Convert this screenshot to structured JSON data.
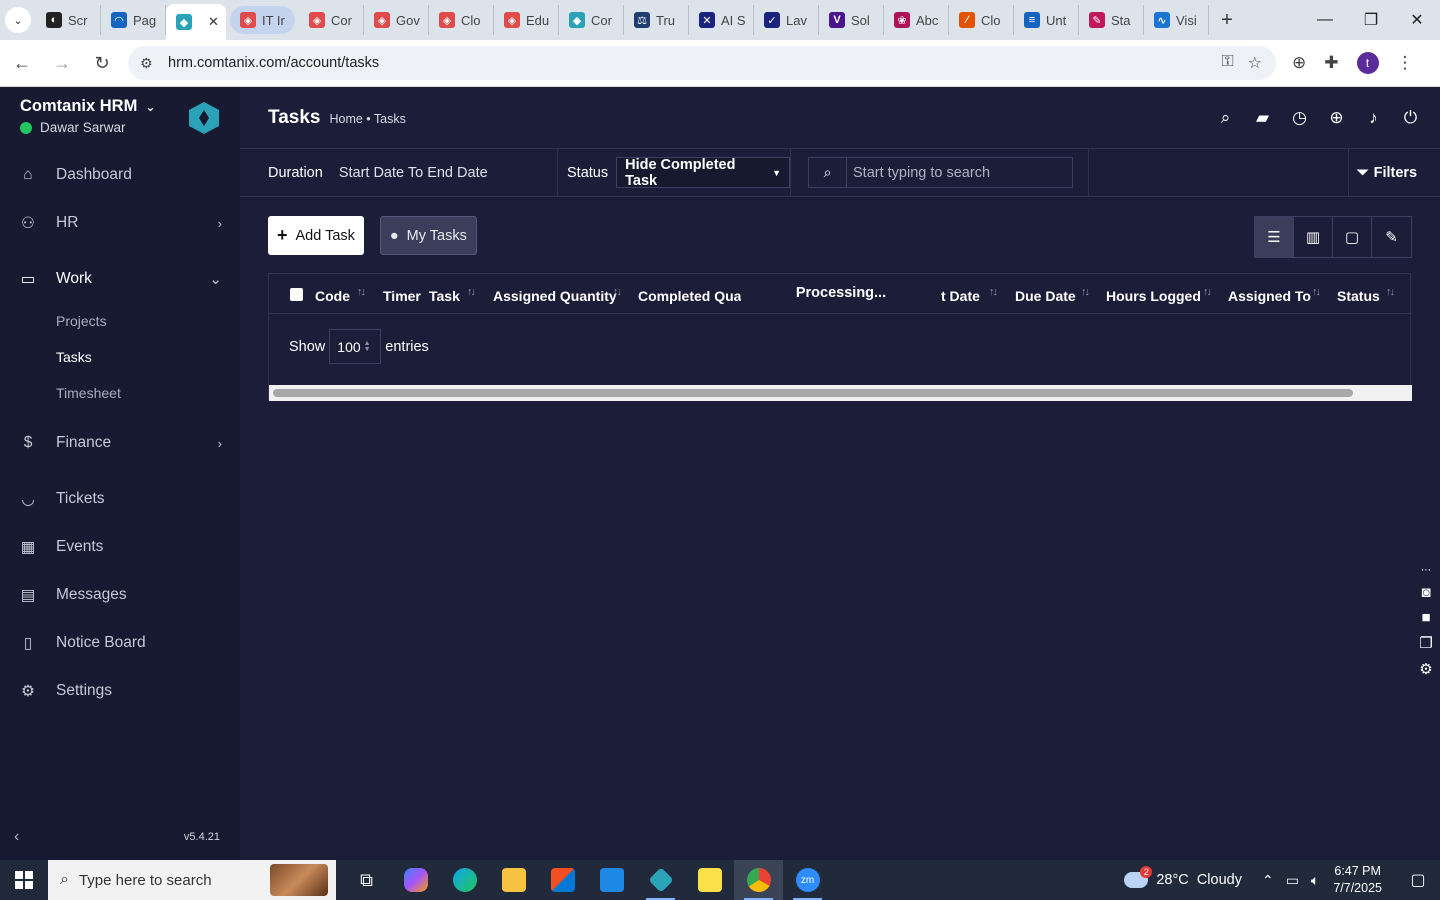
{
  "browser": {
    "tabs": [
      {
        "label": "Scr",
        "color": "#222222",
        "glyph": "◐"
      },
      {
        "label": "Pag",
        "color": "#1565c0",
        "glyph": "◠"
      },
      {
        "label": "",
        "color": "#2aa3b9",
        "glyph": "◆",
        "active": true
      },
      {
        "label": "IT Ir",
        "color": "#e04a4a",
        "glyph": "◈",
        "highlight": true
      },
      {
        "label": "Cor",
        "color": "#e04a4a",
        "glyph": "◈"
      },
      {
        "label": "Gov",
        "color": "#e04a4a",
        "glyph": "◈"
      },
      {
        "label": "Clo",
        "color": "#e04a4a",
        "glyph": "◈"
      },
      {
        "label": "Edu",
        "color": "#e04a4a",
        "glyph": "◈"
      },
      {
        "label": "Cor",
        "color": "#2aa3b9",
        "glyph": "◆"
      },
      {
        "label": "Tru",
        "color": "#1f3d70",
        "glyph": "⚖"
      },
      {
        "label": "AI S",
        "color": "#1a237e",
        "glyph": "✕"
      },
      {
        "label": "Lav",
        "color": "#1a237e",
        "glyph": "✓"
      },
      {
        "label": "Sol",
        "color": "#4a148c",
        "glyph": "V"
      },
      {
        "label": "Abc",
        "color": "#ad1457",
        "glyph": "❀"
      },
      {
        "label": "Clo",
        "color": "#e65100",
        "glyph": "⁄"
      },
      {
        "label": "Unt",
        "color": "#1565c0",
        "glyph": "≡"
      },
      {
        "label": "Sta",
        "color": "#c2185b",
        "glyph": "✎"
      },
      {
        "label": "Visi",
        "color": "#1976d2",
        "glyph": "∿"
      }
    ],
    "url": "hrm.comtanix.com/account/tasks",
    "profile_initial": "t"
  },
  "sidebar": {
    "brand": "Comtanix HRM",
    "user": "Dawar Sarwar",
    "version": "v5.4.21",
    "items": [
      {
        "label": "Dashboard",
        "icon": "home-icon",
        "glyph": "⌂"
      },
      {
        "label": "HR",
        "icon": "users-icon",
        "glyph": "⚇",
        "arrow": "›"
      },
      {
        "label": "Work",
        "icon": "briefcase-icon",
        "glyph": "▭",
        "arrow": "⌄"
      },
      {
        "label": "Finance",
        "icon": "dollar-icon",
        "glyph": "$",
        "arrow": "›"
      },
      {
        "label": "Tickets",
        "icon": "headset-icon",
        "glyph": "◡"
      },
      {
        "label": "Events",
        "icon": "calendar-icon",
        "glyph": "▦"
      },
      {
        "label": "Messages",
        "icon": "message-icon",
        "glyph": "▤"
      },
      {
        "label": "Notice Board",
        "icon": "clipboard-icon",
        "glyph": "▯"
      },
      {
        "label": "Settings",
        "icon": "gear-icon",
        "glyph": "⚙"
      }
    ],
    "work_sub": [
      "Projects",
      "Tasks",
      "Timesheet"
    ]
  },
  "header": {
    "title": "Tasks",
    "breadcrumb": "Home • Tasks"
  },
  "filters": {
    "duration_label": "Duration",
    "duration_value": "Start Date To End Date",
    "status_label": "Status",
    "status_value": "Hide Completed Task",
    "search_placeholder": "Start typing to search",
    "filters_label": "Filters"
  },
  "actions": {
    "add_task": "Add Task",
    "my_tasks": "My Tasks"
  },
  "table": {
    "columns": [
      "Code",
      "Timer",
      "Task",
      "Assigned Quantity",
      "Completed Quan",
      "t Date",
      "Due Date",
      "Hours Logged",
      "Assigned To",
      "Status"
    ],
    "processing": "Processing...",
    "show_label": "Show",
    "entries_value": "100",
    "entries_label": "entries"
  },
  "taskbar": {
    "search_placeholder": "Type here to search",
    "weather": "28°C  Cloudy",
    "weather_badge": "2",
    "time": "6:47 PM",
    "date": "7/7/2025"
  },
  "colors": {
    "sidebar_bg": "#171a31",
    "main_bg": "#1c1e39",
    "online": "#22c55e",
    "logo": "#2aa3b9"
  }
}
